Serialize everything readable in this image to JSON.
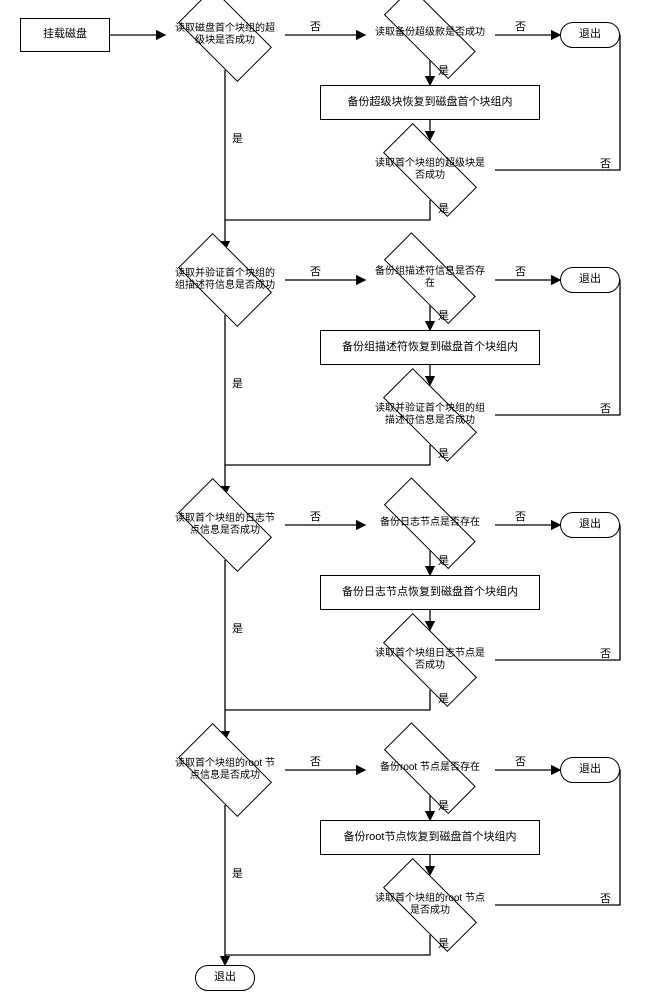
{
  "start": {
    "label": "挂载磁盘"
  },
  "exit": "退出",
  "yes": "是",
  "no": "否",
  "blocks": [
    {
      "check_primary": "读取磁盘首个块组的超级块是否成功",
      "check_backup_exists": "读取备份超级款是否成功",
      "restore_action": "备份超级块恢复到磁盘首个块组内",
      "recheck_primary": "读取首个块组的超级块是否成功"
    },
    {
      "check_primary": "读取并验证首个块组的组描述符信息是否成功",
      "check_backup_exists": "备份组描述符信息是否存在",
      "restore_action": "备份组描述符恢复到磁盘首个块组内",
      "recheck_primary": "读取并验证首个块组的组描述符信息是否成功"
    },
    {
      "check_primary": "读取首个块组的日志节点信息是否成功",
      "check_backup_exists": "备份日志节点是否存在",
      "restore_action": "备份日志节点恢复到磁盘首个块组内",
      "recheck_primary": "读取首个块组日志节点是否成功"
    },
    {
      "check_primary": "读取首个块组的root 节点信息是否成功",
      "check_backup_exists": "备份root 节点是否存在",
      "restore_action": "备份root节点恢复到磁盘首个块组内",
      "recheck_primary": "读取首个块组的root 节点是否成功"
    }
  ]
}
